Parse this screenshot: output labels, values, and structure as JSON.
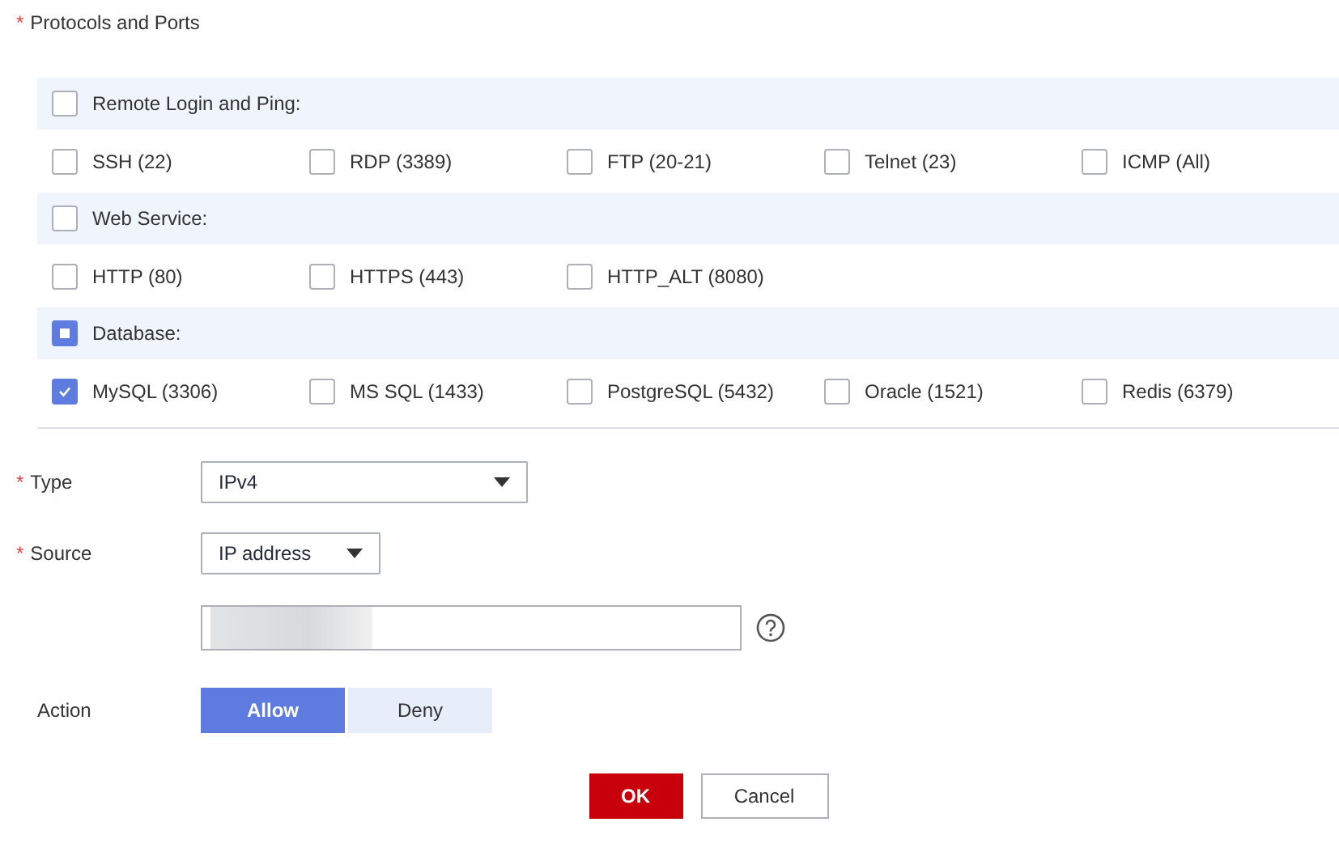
{
  "protocols": {
    "label": "Protocols and Ports",
    "required_mark": "*",
    "groups": [
      {
        "label": "Remote Login and Ping:",
        "indeterminate": false,
        "items": [
          {
            "label": "SSH (22)",
            "checked": false
          },
          {
            "label": "RDP (3389)",
            "checked": false
          },
          {
            "label": "FTP (20-21)",
            "checked": false
          },
          {
            "label": "Telnet (23)",
            "checked": false
          },
          {
            "label": "ICMP (All)",
            "checked": false
          }
        ]
      },
      {
        "label": "Web Service:",
        "indeterminate": false,
        "items": [
          {
            "label": "HTTP (80)",
            "checked": false
          },
          {
            "label": "HTTPS (443)",
            "checked": false
          },
          {
            "label": "HTTP_ALT (8080)",
            "checked": false
          }
        ]
      },
      {
        "label": "Database:",
        "indeterminate": true,
        "items": [
          {
            "label": "MySQL (3306)",
            "checked": true
          },
          {
            "label": "MS SQL (1433)",
            "checked": false
          },
          {
            "label": "PostgreSQL (5432)",
            "checked": false
          },
          {
            "label": "Oracle (1521)",
            "checked": false
          },
          {
            "label": "Redis (6379)",
            "checked": false
          }
        ]
      }
    ]
  },
  "type": {
    "required_mark": "*",
    "label": "Type",
    "value": "IPv4"
  },
  "source": {
    "required_mark": "*",
    "label": "Source",
    "value": "IP address",
    "address_redacted": true
  },
  "action": {
    "label": "Action",
    "options": [
      {
        "label": "Allow",
        "selected": true
      },
      {
        "label": "Deny",
        "selected": false
      }
    ]
  },
  "buttons": [
    {
      "label": "OK",
      "kind": "primary"
    },
    {
      "label": "Cancel",
      "kind": "secondary"
    }
  ]
}
